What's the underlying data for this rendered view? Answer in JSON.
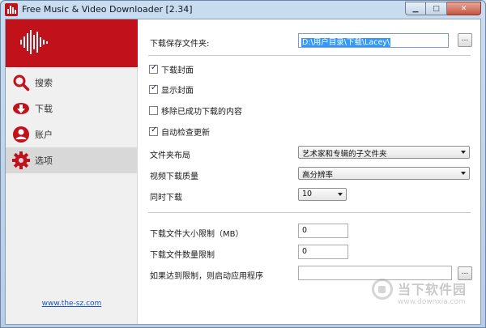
{
  "window": {
    "title": "Free Music & Video Downloader [2.34]"
  },
  "sidebar": {
    "items": [
      {
        "label": "搜索",
        "icon": "search-icon"
      },
      {
        "label": "下载",
        "icon": "cloud-download-icon"
      },
      {
        "label": "账户",
        "icon": "user-icon"
      },
      {
        "label": "选项",
        "icon": "gear-icon",
        "active": true
      }
    ],
    "link": "www.the-sz.com"
  },
  "settings": {
    "save_folder_label": "下载保存文件夹:",
    "save_folder_value": "D:\\用户目录\\下载\\Lacey\\",
    "browse_label": "...",
    "checkboxes": [
      {
        "label": "下载封面",
        "checked": true
      },
      {
        "label": "显示封面",
        "checked": true
      },
      {
        "label": "移除已成功下载的内容",
        "checked": false
      },
      {
        "label": "自动检查更新",
        "checked": true
      }
    ],
    "folder_layout_label": "文件夹布局",
    "folder_layout_value": "艺术家和专辑的子文件夹",
    "video_quality_label": "视频下载质量",
    "video_quality_value": "高分辨率",
    "concurrent_label": "同时下载",
    "concurrent_value": "10",
    "size_limit_label": "下载文件大小限制（MB）",
    "size_limit_value": "0",
    "count_limit_label": "下载文件数量限制",
    "count_limit_value": "0",
    "launch_label": "如果达到限制，则启动应用程序",
    "launch_value": "",
    "launch_browse_label": "..."
  },
  "watermark": {
    "text": "当下软件园",
    "url": "www.downxia.com"
  },
  "colors": {
    "brand": "#c1111a",
    "selection": "#3399ff",
    "link": "#1a55c0"
  }
}
